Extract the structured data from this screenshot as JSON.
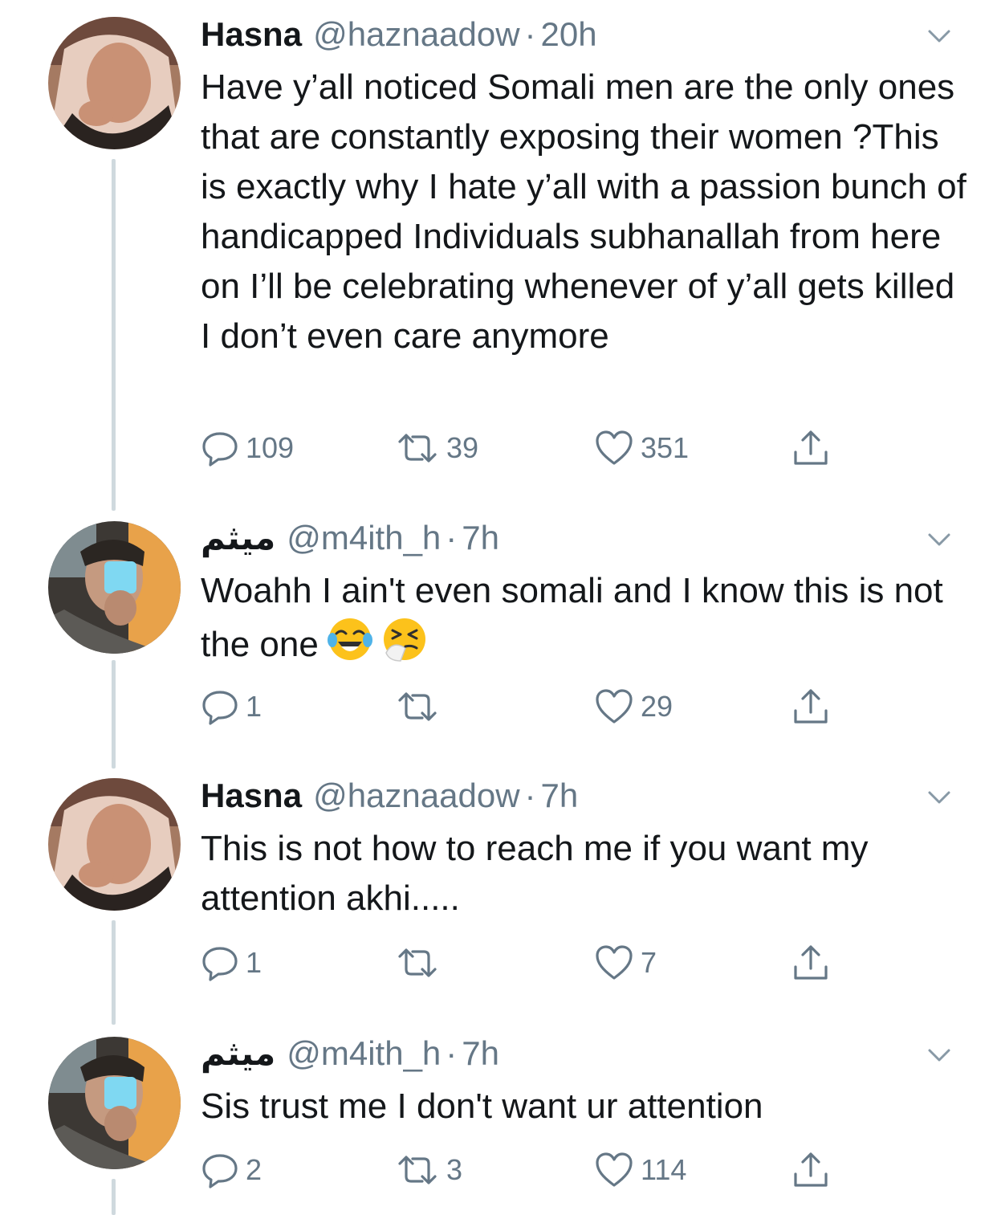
{
  "tweets": [
    {
      "name": "Hasna",
      "handle": "@haznaadow",
      "dot": "·",
      "time": "20h",
      "text": "Have y’all noticed Somali men are the only ones that are constantly exposing their women ?This is exactly why I hate y’all with a passion bunch of handicapped Individuals subhanallah from here on I’ll be celebrating whenever of y’all gets killed I don’t even care anymore",
      "replies": "109",
      "retweets": "39",
      "likes": "351"
    },
    {
      "name": "ميثم",
      "handle": "@m4ith_h",
      "dot": "·",
      "time": "7h",
      "text": "Woahh I ain't even somali and I know this is not the one",
      "emojis": [
        "face-with-tears-of-joy",
        "sneezing-face"
      ],
      "replies": "1",
      "retweets": "",
      "likes": "29"
    },
    {
      "name": "Hasna",
      "handle": "@haznaadow",
      "dot": "·",
      "time": "7h",
      "text": "This is not how to reach me if you want my attention akhi.....",
      "replies": "1",
      "retweets": "",
      "likes": "7"
    },
    {
      "name": "ميثم",
      "handle": "@m4ith_h",
      "dot": "·",
      "time": "7h",
      "text": "Sis trust me I don't want ur attention",
      "replies": "2",
      "retweets": "3",
      "likes": "114"
    }
  ],
  "colors": {
    "text": "#14171a",
    "secondary": "#657786",
    "thread_line": "#cfd9de"
  },
  "icons": [
    "chevron-down-icon",
    "reply-icon",
    "retweet-icon",
    "like-icon",
    "share-icon"
  ]
}
